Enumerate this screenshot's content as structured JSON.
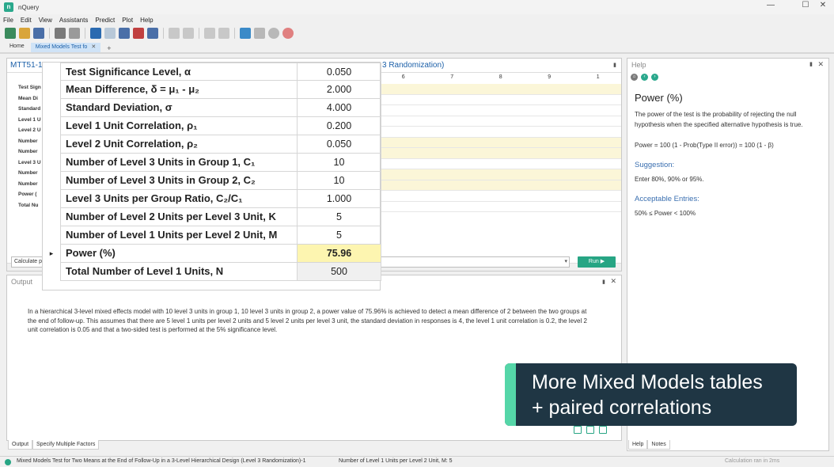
{
  "window": {
    "title": "nQuery",
    "minimize": "—",
    "maximize": "☐",
    "close": "✕"
  },
  "menu": [
    "File",
    "Edit",
    "View",
    "Assistants",
    "Predict",
    "Plot",
    "Help"
  ],
  "tabs": {
    "home": "Home",
    "active": "Mixed Models Test fo",
    "active_close": "✕",
    "add": "+"
  },
  "design": {
    "title_left": "MTT51-1",
    "title_right": "3 Randomization)",
    "pin": "▮",
    "row_labels": [
      "Test Sign",
      "Mean Di",
      "Standard",
      "Level 1 U",
      "Level 2 U",
      "Number",
      "Number",
      "Level 3 U",
      "Number",
      "Number",
      "Power (",
      "Total Nu"
    ],
    "col_heads": [
      "6",
      "7",
      "8",
      "9",
      "1"
    ],
    "calc_mode": "Calculate p",
    "run_label": "Run ▶"
  },
  "table": {
    "rows": [
      {
        "label": "Test Significance Level, α",
        "value": "0.050"
      },
      {
        "label": "Mean Difference, δ = μ₁ - μ₂",
        "value": "2.000"
      },
      {
        "label": "Standard Deviation, σ",
        "value": "4.000"
      },
      {
        "label": "Level 1 Unit Correlation, ρ₁",
        "value": "0.200"
      },
      {
        "label": "Level 2 Unit Correlation, ρ₂",
        "value": "0.050"
      },
      {
        "label": "Number of Level 3 Units in Group 1, C₁",
        "value": "10"
      },
      {
        "label": "Number of Level 3 Units in Group 2, C₂",
        "value": "10"
      },
      {
        "label": "Level 3 Units per Group Ratio, C₂/C₁",
        "value": "1.000"
      },
      {
        "label": "Number of Level 2 Units per Level 3 Unit, K",
        "value": "5"
      },
      {
        "label": "Number of Level 1 Units per Level 2 Unit, M",
        "value": "5"
      },
      {
        "label": "Power (%)",
        "value": "75.96"
      },
      {
        "label": "Total Number of Level 1 Units, N",
        "value": "500"
      }
    ],
    "selected_marker": "▸"
  },
  "help": {
    "title": "Help",
    "pin": "▮",
    "close": "✕",
    "heading": "Power (%)",
    "paragraph1": "The power of the test is the probability of rejecting the null hypothesis when the specified alternative hypothesis is true.",
    "formula": "Power = 100 (1 - Prob(Type II error)) = 100 (1 - β)",
    "suggestion_title": "Suggestion:",
    "suggestion_text": "Enter 80%, 90% or 95%.",
    "acceptable_title": "Acceptable Entries:",
    "acceptable_text": "50% ≤ Power < 100%",
    "tab_help": "Help",
    "tab_notes": "Notes"
  },
  "output": {
    "title": "Output",
    "pin": "▮",
    "close": "✕",
    "text": "In a hierarchical 3-level mixed effects model with 10 level 3 units in group 1, 10 level 3 units in group 2, a power value of 75.96% is achieved to detect a mean difference of 2 between the two groups at the end of follow-up. This assumes that there are 5 level 1 units per level 2 units and 5 level 2 units per level 3 unit, the standard deviation in responses is 4, the level 1 unit correlation is 0.2, the level 2 unit correlation is 0.05 and that a two-sided test is performed at the 5% significance level.",
    "tab_output": "Output",
    "tab_specify": "Specify Multiple Factors"
  },
  "callout": {
    "line1": "More Mixed Models tables",
    "line2": "+ paired correlations"
  },
  "status": {
    "left": "Mixed Models Test for Two Means at the End of Follow-Up in a 3-Level Hierarchical Design (Level 3 Randomization)-1",
    "middle": "Number of Level 1 Units per Level 2 Unit, M: 5",
    "right": "Calculation ran in 2ms"
  },
  "colors": {
    "accent_green": "#27a584",
    "callout_bg": "#1f3644",
    "callout_bar": "#55d6a8",
    "power_highlight": "#fdf5b0",
    "link_blue": "#1b5fa8"
  }
}
